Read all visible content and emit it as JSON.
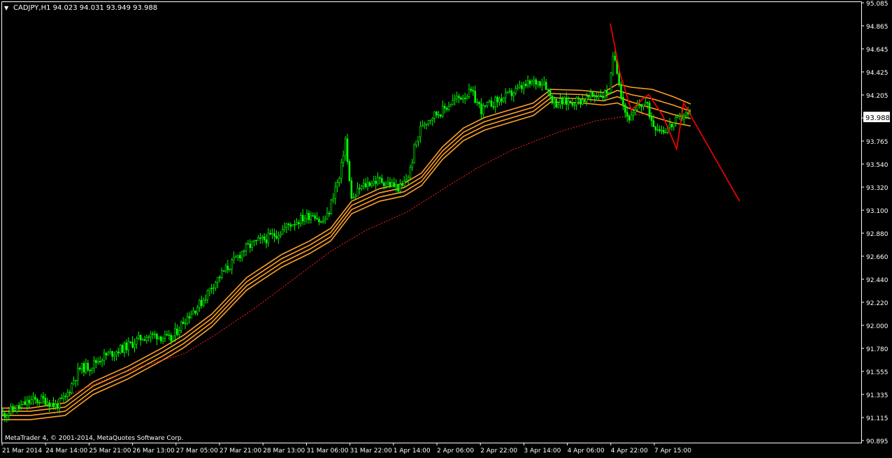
{
  "header": {
    "menu_glyph": "▼",
    "symbol_info": "CADJPY,H1  94.023 94.031 93.949 93.988"
  },
  "copyright": "MetaTrader 4, © 2001-2014, MetaQuotes Software Corp.",
  "colors": {
    "background": "#000000",
    "axis": "#ffffff",
    "candle_bull": "#00ff00",
    "candle_bear": "#00ff00",
    "ma_band": "#ffa024",
    "ma_slow": "#ff2020",
    "trendline": "#ff0000",
    "price_label_bg": "#ffffff",
    "price_label_text": "#000000"
  },
  "chart_data": {
    "type": "candlestick",
    "symbol": "CADJPY",
    "timeframe": "H1",
    "last_ohlc": {
      "open": 94.023,
      "high": 94.031,
      "low": 93.949,
      "close": 93.988
    },
    "current_price_label": "93.988",
    "ylim": [
      90.87,
      95.085
    ],
    "y_ticks": [
      "95.085",
      "94.865",
      "94.645",
      "94.425",
      "94.205",
      "93.988",
      "93.765",
      "93.540",
      "93.320",
      "93.100",
      "92.880",
      "92.660",
      "92.440",
      "92.220",
      "92.000",
      "91.780",
      "91.555",
      "91.335",
      "91.115",
      "90.895"
    ],
    "x_ticks": [
      "21 Mar 2014",
      "24 Mar 14:00",
      "25 Mar 21:00",
      "26 Mar 13:00",
      "27 Mar 05:00",
      "27 Mar 21:00",
      "28 Mar 13:00",
      "31 Mar 06:00",
      "31 Mar 22:00",
      "1 Apr 14:00",
      "2 Apr 06:00",
      "2 Apr 22:00",
      "3 Apr 14:00",
      "4 Apr 06:00",
      "4 Apr 22:00",
      "7 Apr 15:00"
    ],
    "price_path": [
      [
        0,
        91.14
      ],
      [
        20,
        91.2
      ],
      [
        40,
        91.27
      ],
      [
        60,
        91.28
      ],
      [
        75,
        91.22
      ],
      [
        90,
        91.3
      ],
      [
        100,
        91.45
      ],
      [
        110,
        91.58
      ],
      [
        125,
        91.6
      ],
      [
        140,
        91.68
      ],
      [
        160,
        91.74
      ],
      [
        180,
        91.8
      ],
      [
        200,
        91.88
      ],
      [
        220,
        91.9
      ],
      [
        240,
        91.85
      ],
      [
        260,
        92.05
      ],
      [
        275,
        92.15
      ],
      [
        285,
        92.22
      ],
      [
        300,
        92.38
      ],
      [
        315,
        92.5
      ],
      [
        330,
        92.6
      ],
      [
        345,
        92.72
      ],
      [
        360,
        92.78
      ],
      [
        380,
        92.83
      ],
      [
        395,
        92.88
      ],
      [
        410,
        92.96
      ],
      [
        430,
        93.02
      ],
      [
        445,
        93.07
      ],
      [
        455,
        92.97
      ],
      [
        465,
        93.04
      ],
      [
        475,
        93.3
      ],
      [
        482,
        93.4
      ],
      [
        490,
        93.78
      ],
      [
        495,
        93.4
      ],
      [
        500,
        93.18
      ],
      [
        510,
        93.3
      ],
      [
        525,
        93.36
      ],
      [
        540,
        93.38
      ],
      [
        555,
        93.34
      ],
      [
        570,
        93.3
      ],
      [
        582,
        93.45
      ],
      [
        590,
        93.72
      ],
      [
        600,
        93.92
      ],
      [
        615,
        94.0
      ],
      [
        630,
        94.05
      ],
      [
        640,
        94.12
      ],
      [
        655,
        94.18
      ],
      [
        670,
        94.22
      ],
      [
        685,
        94.05
      ],
      [
        700,
        94.12
      ],
      [
        720,
        94.18
      ],
      [
        740,
        94.26
      ],
      [
        760,
        94.32
      ],
      [
        775,
        94.33
      ],
      [
        782,
        94.2
      ],
      [
        790,
        94.12
      ],
      [
        810,
        94.13
      ],
      [
        830,
        94.15
      ],
      [
        850,
        94.2
      ],
      [
        860,
        94.2
      ],
      [
        868,
        94.25
      ],
      [
        874,
        94.6
      ],
      [
        880,
        94.4
      ],
      [
        886,
        94.15
      ],
      [
        892,
        94.0
      ],
      [
        900,
        93.97
      ],
      [
        910,
        94.1
      ],
      [
        920,
        94.12
      ],
      [
        930,
        93.92
      ],
      [
        945,
        93.86
      ],
      [
        955,
        93.9
      ],
      [
        965,
        93.95
      ],
      [
        975,
        94.02
      ],
      [
        985,
        93.99
      ]
    ],
    "ma_band_paths": [
      [
        [
          0,
          91.2
        ],
        [
          40,
          91.2
        ],
        [
          90,
          91.25
        ],
        [
          130,
          91.45
        ],
        [
          180,
          91.6
        ],
        [
          230,
          91.78
        ],
        [
          260,
          91.9
        ],
        [
          300,
          92.1
        ],
        [
          350,
          92.45
        ],
        [
          400,
          92.67
        ],
        [
          440,
          92.8
        ],
        [
          470,
          92.92
        ],
        [
          500,
          93.18
        ],
        [
          540,
          93.3
        ],
        [
          575,
          93.35
        ],
        [
          600,
          93.45
        ],
        [
          630,
          93.7
        ],
        [
          660,
          93.88
        ],
        [
          690,
          93.98
        ],
        [
          720,
          94.04
        ],
        [
          760,
          94.12
        ],
        [
          785,
          94.25
        ],
        [
          830,
          94.24
        ],
        [
          860,
          94.22
        ],
        [
          880,
          94.3
        ],
        [
          900,
          94.27
        ],
        [
          930,
          94.25
        ],
        [
          960,
          94.18
        ],
        [
          985,
          94.11
        ]
      ],
      [
        [
          0,
          91.17
        ],
        [
          40,
          91.17
        ],
        [
          90,
          91.21
        ],
        [
          130,
          91.41
        ],
        [
          180,
          91.56
        ],
        [
          230,
          91.74
        ],
        [
          260,
          91.86
        ],
        [
          300,
          92.06
        ],
        [
          350,
          92.41
        ],
        [
          400,
          92.63
        ],
        [
          440,
          92.76
        ],
        [
          470,
          92.88
        ],
        [
          500,
          93.14
        ],
        [
          540,
          93.26
        ],
        [
          575,
          93.31
        ],
        [
          600,
          93.41
        ],
        [
          630,
          93.66
        ],
        [
          660,
          93.84
        ],
        [
          690,
          93.94
        ],
        [
          720,
          94.0
        ],
        [
          760,
          94.08
        ],
        [
          785,
          94.21
        ],
        [
          830,
          94.2
        ],
        [
          860,
          94.18
        ],
        [
          880,
          94.24
        ],
        [
          900,
          94.2
        ],
        [
          930,
          94.16
        ],
        [
          960,
          94.1
        ],
        [
          985,
          94.04
        ]
      ],
      [
        [
          0,
          91.13
        ],
        [
          40,
          91.13
        ],
        [
          90,
          91.17
        ],
        [
          130,
          91.37
        ],
        [
          180,
          91.52
        ],
        [
          230,
          91.7
        ],
        [
          260,
          91.82
        ],
        [
          300,
          92.02
        ],
        [
          350,
          92.37
        ],
        [
          400,
          92.59
        ],
        [
          440,
          92.72
        ],
        [
          470,
          92.84
        ],
        [
          500,
          93.1
        ],
        [
          540,
          93.22
        ],
        [
          575,
          93.27
        ],
        [
          600,
          93.37
        ],
        [
          630,
          93.62
        ],
        [
          660,
          93.8
        ],
        [
          690,
          93.9
        ],
        [
          720,
          93.96
        ],
        [
          760,
          94.04
        ],
        [
          785,
          94.17
        ],
        [
          830,
          94.16
        ],
        [
          860,
          94.14
        ],
        [
          880,
          94.18
        ],
        [
          900,
          94.13
        ],
        [
          930,
          94.07
        ],
        [
          960,
          94.01
        ],
        [
          985,
          93.97
        ]
      ],
      [
        [
          0,
          91.09
        ],
        [
          40,
          91.09
        ],
        [
          90,
          91.13
        ],
        [
          130,
          91.33
        ],
        [
          180,
          91.48
        ],
        [
          230,
          91.66
        ],
        [
          260,
          91.78
        ],
        [
          300,
          91.98
        ],
        [
          350,
          92.33
        ],
        [
          400,
          92.55
        ],
        [
          440,
          92.68
        ],
        [
          470,
          92.8
        ],
        [
          500,
          93.06
        ],
        [
          540,
          93.18
        ],
        [
          575,
          93.23
        ],
        [
          600,
          93.33
        ],
        [
          630,
          93.58
        ],
        [
          660,
          93.76
        ],
        [
          690,
          93.86
        ],
        [
          720,
          93.92
        ],
        [
          760,
          94.0
        ],
        [
          785,
          94.13
        ],
        [
          830,
          94.12
        ],
        [
          860,
          94.1
        ],
        [
          880,
          94.12
        ],
        [
          900,
          94.06
        ],
        [
          930,
          93.99
        ],
        [
          960,
          93.93
        ],
        [
          985,
          93.9
        ]
      ]
    ],
    "ma_slow_path": [
      [
        0,
        91.2
      ],
      [
        80,
        91.28
      ],
      [
        150,
        91.48
      ],
      [
        200,
        91.6
      ],
      [
        260,
        91.72
      ],
      [
        300,
        91.88
      ],
      [
        360,
        92.15
      ],
      [
        420,
        92.45
      ],
      [
        470,
        92.7
      ],
      [
        520,
        92.9
      ],
      [
        580,
        93.08
      ],
      [
        620,
        93.25
      ],
      [
        680,
        93.5
      ],
      [
        730,
        93.67
      ],
      [
        760,
        93.75
      ],
      [
        800,
        93.85
      ],
      [
        850,
        93.95
      ],
      [
        900,
        94.0
      ],
      [
        930,
        94.02
      ]
    ],
    "zigzag_path": [
      [
        870,
        94.88
      ],
      [
        884,
        94.4
      ],
      [
        900,
        94.05
      ],
      [
        915,
        94.15
      ],
      [
        925,
        94.2
      ],
      [
        945,
        94.0
      ],
      [
        965,
        93.68
      ],
      [
        975,
        94.12
      ],
      [
        985,
        94.0
      ],
      [
        1055,
        93.18
      ]
    ]
  }
}
